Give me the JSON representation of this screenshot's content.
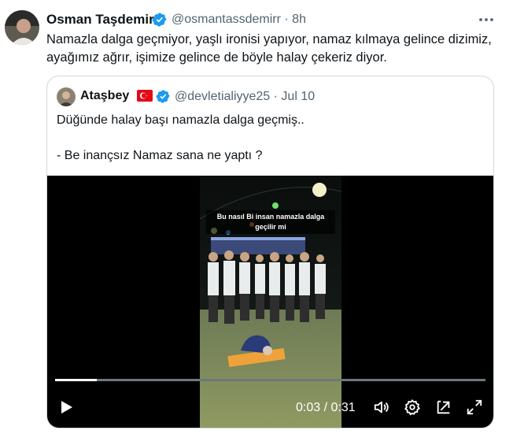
{
  "outer_tweet": {
    "author_name": "Osman Taşdemir",
    "handle": "@osmantassdemirr",
    "time": "· 8h",
    "text": "Namazla dalga geçmiyor, yaşlı ironisi yapıyor, namaz kılmaya gelince dizimiz, ayağımız ağrır, işimize gelince de böyle halay çekeriz diyor.",
    "icons": {
      "verified": "verified-badge-icon",
      "more": "more-options-icon"
    },
    "colors": {
      "verified": "#1d9bf0",
      "secondary_text": "#536471"
    }
  },
  "quoted_tweet": {
    "author_name": "Ataşbey",
    "handle": "@devletialiyye25",
    "time": "· Jul 10",
    "line1": "Düğünde halay başı namazla dalga geçmiş..",
    "line2": "- Be inançsız Namaz sana ne yaptı ?",
    "icons": {
      "flag": "turkey-flag-icon",
      "verified": "verified-badge-icon"
    }
  },
  "video": {
    "caption": "Bu nasıl Bi insan namazla dalga geçilir mi",
    "time_display": "0:03 / 0:31",
    "progress": 0.097,
    "icons": [
      "play-icon",
      "volume-icon",
      "settings-icon",
      "pop-out-icon",
      "fullscreen-icon"
    ]
  }
}
